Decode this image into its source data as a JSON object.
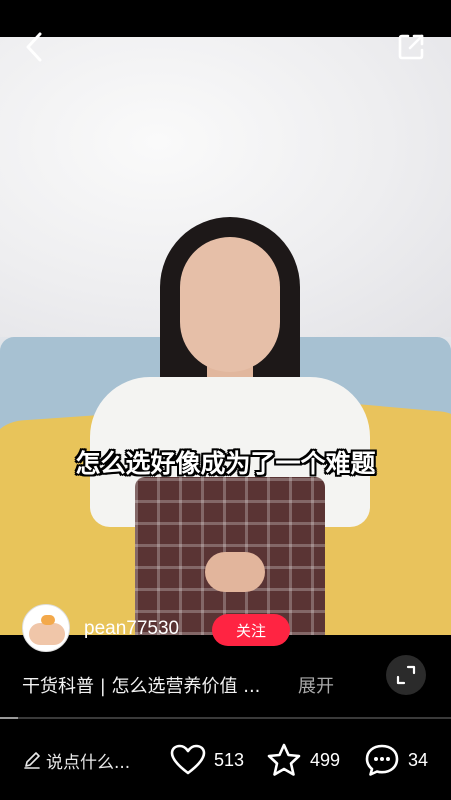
{
  "video": {
    "caption": "怎么选好像成为了一个难题"
  },
  "author": {
    "username": "pean77530",
    "follow_label": "关注"
  },
  "post": {
    "description": "干货科普 | 怎么选营养价值 ...",
    "expand_label": "展开"
  },
  "playback": {
    "progress": 0.04
  },
  "bottom_bar": {
    "comment_placeholder": "说点什么...",
    "likes": "513",
    "collects": "499",
    "comments": "34"
  },
  "colors": {
    "follow_button": "#ff2442",
    "background": "#000000"
  }
}
